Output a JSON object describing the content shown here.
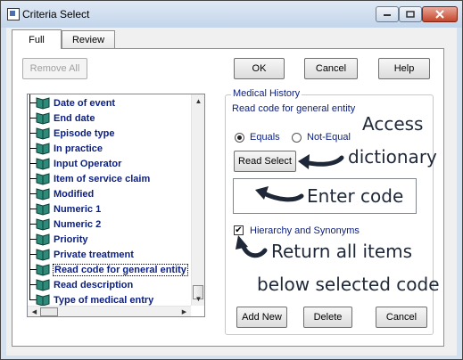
{
  "window": {
    "title": "Criteria Select"
  },
  "tabs": [
    {
      "label": "Full"
    },
    {
      "label": "Review"
    }
  ],
  "toolbar": {
    "remove_all_label": "Remove All",
    "ok_label": "OK",
    "cancel_label": "Cancel",
    "help_label": "Help"
  },
  "list": {
    "items": [
      {
        "label": "Date of event"
      },
      {
        "label": "End date"
      },
      {
        "label": "Episode type"
      },
      {
        "label": "In practice"
      },
      {
        "label": "Input Operator"
      },
      {
        "label": "Item of service claim"
      },
      {
        "label": "Modified"
      },
      {
        "label": "Numeric 1"
      },
      {
        "label": "Numeric 2"
      },
      {
        "label": "Priority"
      },
      {
        "label": "Private treatment"
      },
      {
        "label": "Read code for general entity"
      },
      {
        "label": "Read description"
      },
      {
        "label": "Type of medical entry"
      }
    ],
    "selected_index": 11
  },
  "group": {
    "caption": "Medical History",
    "subtitle": "Read code for general entity",
    "equals_label": "Equals",
    "not_equal_label": "Not-Equal",
    "equals_selected": true,
    "read_select_label": "Read Select",
    "code_value": "",
    "hierarchy_label": "Hierarchy and Synonyms",
    "hierarchy_checked": true,
    "add_new_label": "Add New",
    "delete_label": "Delete",
    "cancel_label": "Cancel"
  },
  "annotations": {
    "access": "Access",
    "dictionary": "dictionary",
    "enter_code": "Enter code",
    "return_all": "Return all items",
    "below_selected": "below selected code"
  },
  "colors": {
    "title_bar": "#c3d5ea",
    "close_button": "#c5442a",
    "item_text": "#0a1e80",
    "annotation": "#1e2838"
  }
}
